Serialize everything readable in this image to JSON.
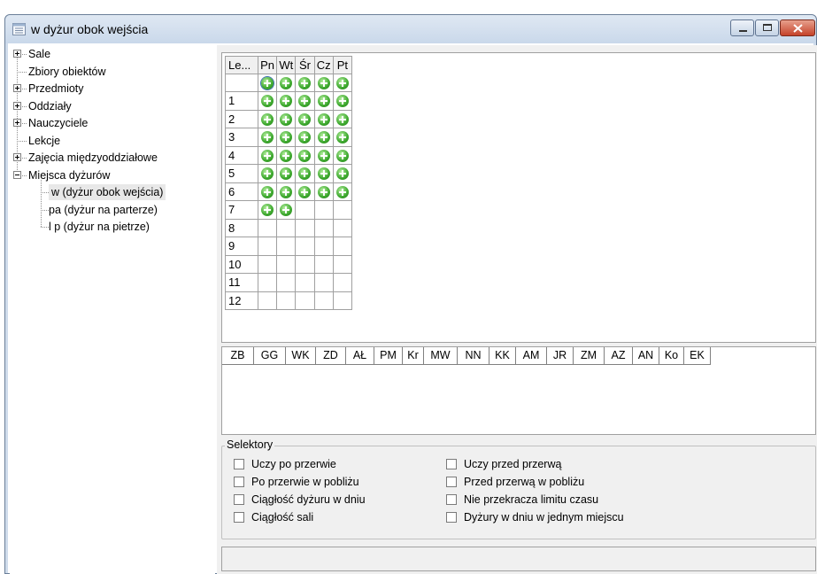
{
  "window": {
    "title": "w dyżur obok wejścia"
  },
  "tree": {
    "items": [
      {
        "label": "Sale",
        "expander": "plus"
      },
      {
        "label": "Zbiory obiektów",
        "expander": "none"
      },
      {
        "label": "Przedmioty",
        "expander": "plus"
      },
      {
        "label": "Oddziały",
        "expander": "plus"
      },
      {
        "label": "Nauczyciele",
        "expander": "plus"
      },
      {
        "label": "Lekcje",
        "expander": "none"
      },
      {
        "label": "Zajęcia międzyoddziałowe",
        "expander": "plus"
      },
      {
        "label": "Miejsca dyżurów",
        "expander": "minus"
      }
    ],
    "children": [
      {
        "label": "w (dyżur obok wejścia)",
        "selected": true
      },
      {
        "label": "pa (dyżur na parterze)",
        "selected": false
      },
      {
        "label": "l p (dyżur na pietrze)",
        "selected": false
      }
    ]
  },
  "schedule": {
    "corner_label": "Le...",
    "days": [
      "Pn",
      "Wt",
      "Śr",
      "Cz",
      "Pt"
    ],
    "rows": [
      {
        "label": "",
        "marks": [
          true,
          true,
          true,
          true,
          true
        ]
      },
      {
        "label": "1",
        "marks": [
          true,
          true,
          true,
          true,
          true
        ]
      },
      {
        "label": "2",
        "marks": [
          true,
          true,
          true,
          true,
          true
        ]
      },
      {
        "label": "3",
        "marks": [
          true,
          true,
          true,
          true,
          true
        ]
      },
      {
        "label": "4",
        "marks": [
          true,
          true,
          true,
          true,
          true
        ]
      },
      {
        "label": "5",
        "marks": [
          true,
          true,
          true,
          true,
          true
        ]
      },
      {
        "label": "6",
        "marks": [
          true,
          true,
          true,
          true,
          true
        ]
      },
      {
        "label": "7",
        "marks": [
          true,
          true,
          false,
          false,
          false
        ]
      },
      {
        "label": "8",
        "marks": [
          false,
          false,
          false,
          false,
          false
        ]
      },
      {
        "label": "9",
        "marks": [
          false,
          false,
          false,
          false,
          false
        ]
      },
      {
        "label": "10",
        "marks": [
          false,
          false,
          false,
          false,
          false
        ]
      },
      {
        "label": "11",
        "marks": [
          false,
          false,
          false,
          false,
          false
        ]
      },
      {
        "label": "12",
        "marks": [
          false,
          false,
          false,
          false,
          false
        ]
      }
    ]
  },
  "teachers": [
    "ZB",
    "GG",
    "WK",
    "ZD",
    "AŁ",
    "PM",
    "Kr",
    "MW",
    "NN",
    "KK",
    "AM",
    "JR",
    "ZM",
    "AZ",
    "AN",
    "Ko",
    "EK"
  ],
  "selectors": {
    "title": "Selektory",
    "left": [
      "Uczy po przerwie",
      "Po przerwie w pobliżu",
      "Ciągłość dyżuru w dniu",
      "Ciągłość sali"
    ],
    "right": [
      "Uczy przed przerwą",
      "Przed przerwą w pobliżu",
      "Nie przekracza limitu czasu",
      "Dyżury w dniu w jednym miejscu"
    ]
  },
  "status_text": ""
}
